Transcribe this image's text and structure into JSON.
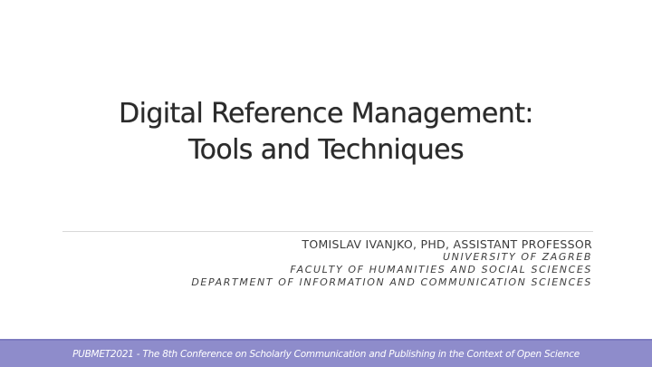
{
  "slide": {
    "title_lines": [
      "Digital Reference Management:",
      "Tools and Techniques"
    ],
    "author": "TOMISLAV IVANJKO, PHD, ASSISTANT PROFESSOR",
    "affiliations": [
      "UNIVERSITY OF ZAGREB",
      "FACULTY OF HUMANITIES AND SOCIAL SCIENCES",
      "DEPARTMENT OF INFORMATION AND COMMUNICATION SCIENCES"
    ],
    "footer": "PUBMET2021 - The 8th Conference on Scholarly Communication and Publishing in the Context of Open Science"
  },
  "colors": {
    "footer_bar": "#8e8ccb",
    "title_text": "#2b2b2b"
  }
}
